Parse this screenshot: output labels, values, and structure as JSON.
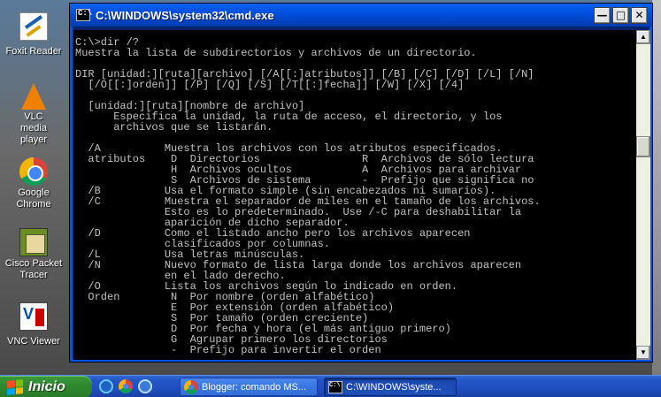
{
  "desktop": {
    "icons": [
      {
        "label": "Foxit Reader"
      },
      {
        "label": "VLC media player"
      },
      {
        "label": "Google Chrome"
      },
      {
        "label": "Cisco Packet Tracer"
      },
      {
        "label": "VNC Viewer"
      }
    ]
  },
  "window": {
    "title": "C:\\WINDOWS\\system32\\cmd.exe",
    "minimize_icon": "minimize-icon",
    "maximize_icon": "maximize-icon",
    "close_icon": "close-icon",
    "console_text": "C:\\>dir /?\nMuestra la lista de subdirectorios y archivos de un directorio.\n\nDIR [unidad:][ruta][archivo] [/A[[:]atributos]] [/B] [/C] [/D] [/L] [/N]\n  [/O[[:]orden]] [/P] [/Q] [/S] [/T[[:]fecha]] [/W] [/X] [/4]\n\n  [unidad:][ruta][nombre de archivo]\n      Especifica la unidad, la ruta de acceso, el directorio, y los\n      archivos que se listarán.\n\n  /A          Muestra los archivos con los atributos especificados.\n  atributos    D  Directorios                R  Archivos de sólo lectura\n               H  Archivos ocultos           A  Archivos para archivar\n               S  Archivos de sistema        -  Prefijo que significa no\n  /B          Usa el formato simple (sin encabezados ni sumarios).\n  /C          Muestra el separador de miles en el tamaño de los archivos.\n              Esto es lo predeterminado.  Use /-C para deshabilitar la\n              aparición de dicho separador.\n  /D          Como el listado ancho pero los archivos aparecen\n              clasificados por columnas.\n  /L          Usa letras minúsculas.\n  /N          Nuevo formato de lista larga donde los archivos aparecen\n              en el lado derecho.\n  /O          Lista los archivos según lo indicado en orden.\n  Orden        N  Por nombre (orden alfabético)\n               E  Por extensión (orden alfabético)\n               S  Por tamaño (orden creciente)\n               D  Por fecha y hora (el más antiguo primero)\n               G  Agrupar primero los directorios\n               -  Prefijo para invertir el orden"
  },
  "taskbar": {
    "start_label": "Inicio",
    "tasks": [
      {
        "label": "Blogger: comando MS..."
      },
      {
        "label": "C:\\WINDOWS\\syste..."
      }
    ]
  },
  "colors": {
    "console_bg": "#000000",
    "console_fg": "#c0c0c0",
    "titlebar": "#0054e3",
    "start_green": "#2f8a2f"
  }
}
